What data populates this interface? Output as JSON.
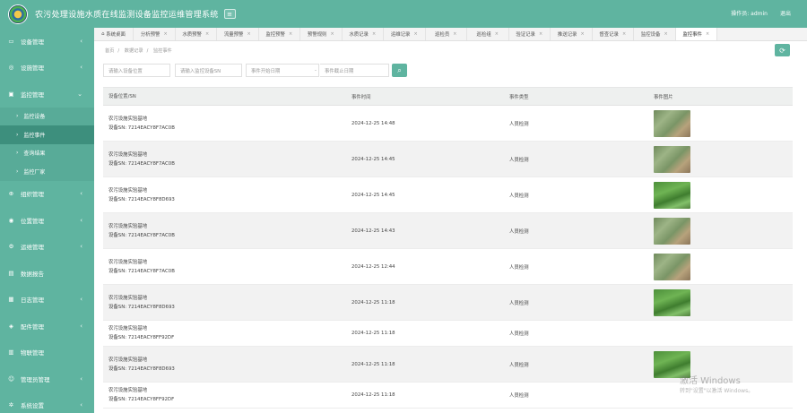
{
  "header": {
    "title": "农污处理设施水质在线监测设备监控运维管理系统",
    "user": "操作员: admin",
    "logout": "退出"
  },
  "sidebar": {
    "items": [
      {
        "label": "设备管理",
        "icon": "device-icon"
      },
      {
        "label": "设施管理",
        "icon": "facility-icon"
      },
      {
        "label": "监控管理",
        "icon": "monitor-icon"
      },
      {
        "label": "组织管理",
        "icon": "org-icon"
      },
      {
        "label": "位置管理",
        "icon": "location-icon"
      },
      {
        "label": "运维管理",
        "icon": "ops-icon"
      },
      {
        "label": "数据报告",
        "icon": "report-icon"
      },
      {
        "label": "日志管理",
        "icon": "log-icon"
      },
      {
        "label": "配件管理",
        "icon": "parts-icon"
      },
      {
        "label": "物联管理",
        "icon": "iot-icon"
      },
      {
        "label": "管理员管理",
        "icon": "admin-icon"
      },
      {
        "label": "系统设置",
        "icon": "settings-icon"
      }
    ],
    "sub": [
      "监控设备",
      "监控事件",
      "查询结果",
      "监控厂家"
    ]
  },
  "tabs": [
    "系统桌面",
    "分析预警",
    "水质预警",
    "流量预警",
    "监控预警",
    "预警规则",
    "水质记录",
    "运维记录",
    "巡检员",
    "巡检组",
    "验证记录",
    "推送记录",
    "督查记录",
    "监控设备",
    "监控事件"
  ],
  "breadcrumb": [
    "首页",
    "数据记录",
    "监控事件"
  ],
  "filters": {
    "location": "请输入设备位置",
    "sn": "请输入监控设备SN",
    "start": "事件开始日期",
    "dash": "-",
    "end": "事件截止日期"
  },
  "table": {
    "headers": [
      "设备位置/SN",
      "事件时间",
      "事件类型",
      "事件图片"
    ],
    "rows": [
      {
        "loc": "农污设施实验基地",
        "sn": "设备SN: 7214EACY8F7AC0B",
        "time": "2024-12-25 14:48",
        "type": "人员检测",
        "img": "a"
      },
      {
        "loc": "农污设施实验基地",
        "sn": "设备SN: 7214EACY8F7AC0B",
        "time": "2024-12-25 14:45",
        "type": "人员检测",
        "img": "a"
      },
      {
        "loc": "农污设施实验基地",
        "sn": "设备SN: 7214EACY8F8D693",
        "time": "2024-12-25 14:45",
        "type": "人员检测",
        "img": "b"
      },
      {
        "loc": "农污设施实验基地",
        "sn": "设备SN: 7214EACY8F7AC0B",
        "time": "2024-12-25 14:43",
        "type": "人员检测",
        "img": "a"
      },
      {
        "loc": "农污设施实验基地",
        "sn": "设备SN: 7214EACY8F7AC0B",
        "time": "2024-12-25 12:44",
        "type": "人员检测",
        "img": "a"
      },
      {
        "loc": "农污设施实验基地",
        "sn": "设备SN: 7214EACY8F8D693",
        "time": "2024-12-25 11:18",
        "type": "人员检测",
        "img": "b"
      },
      {
        "loc": "农污设施实验基地",
        "sn": "设备SN: 7214EACY8FF92DF",
        "time": "2024-12-25 11:18",
        "type": "人员检测",
        "img": ""
      },
      {
        "loc": "农污设施实验基地",
        "sn": "设备SN: 7214EACY8F8D693",
        "time": "2024-12-25 11:18",
        "type": "人员检测",
        "img": "b"
      },
      {
        "loc": "农污设施实验基地",
        "sn": "设备SN: 7214EACY8FF92DF",
        "time": "2024-12-25 11:18",
        "type": "人员检测",
        "img": ""
      }
    ]
  },
  "watermark": {
    "line1": "激活 Windows",
    "line2": "转到\"设置\"以激活 Windows。"
  },
  "colors": {
    "primary": "#5fb4a0",
    "active_sub": "#3d8f7d"
  }
}
